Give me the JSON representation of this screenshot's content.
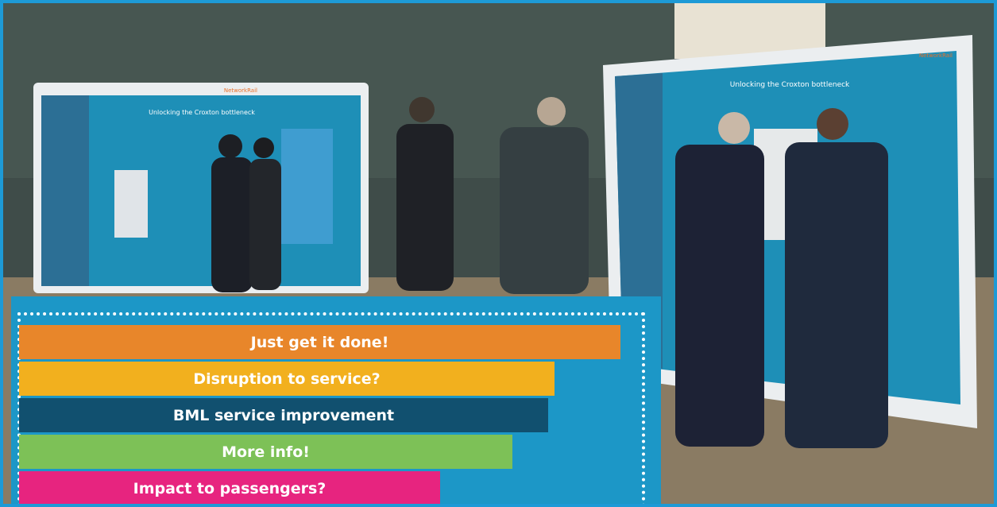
{
  "colors": {
    "frame_border": "#1d9ad6",
    "panel_background": "#1c97c7"
  },
  "photo": {
    "left_display_wordmark": "NetworkRail",
    "left_display_title": "Unlocking the Croxton bottleneck",
    "right_display_wordmark": "NetworkRail",
    "right_display_title": "Unlocking the Croxton bottleneck"
  },
  "chart_data": {
    "type": "bar",
    "orientation": "horizontal",
    "categories": [
      "Just get it done!",
      "Disruption to service?",
      "BML service improvement",
      "More info!",
      "Impact to passengers?"
    ],
    "values": [
      100,
      89,
      88,
      82,
      70
    ],
    "bar_colors": [
      "#e8862a",
      "#f2b01e",
      "#11506f",
      "#7dc157",
      "#e7247f"
    ],
    "title": "",
    "xlabel": "",
    "ylabel": "",
    "xlim": [
      0,
      100
    ],
    "grid": false,
    "legend": "none"
  }
}
